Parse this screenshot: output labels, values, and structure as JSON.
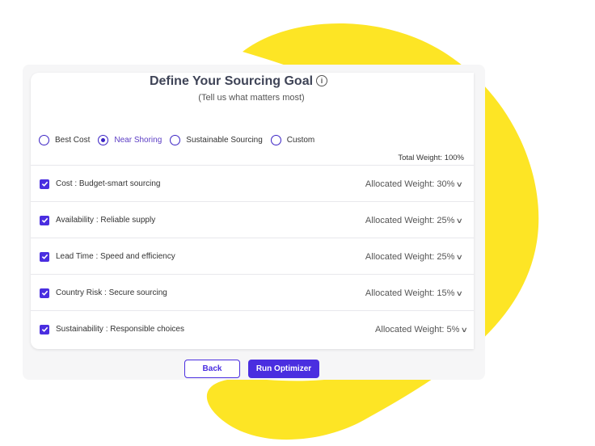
{
  "header": {
    "title": "Define Your Sourcing Goal",
    "subtitle": "(Tell us what matters most)"
  },
  "goal_options": [
    {
      "label": "Best Cost",
      "selected": false
    },
    {
      "label": "Near Shoring",
      "selected": true
    },
    {
      "label": "Sustainable Sourcing",
      "selected": false
    },
    {
      "label": "Custom",
      "selected": false
    }
  ],
  "total_weight_label": "Total Weight: 100%",
  "criteria": [
    {
      "label": "Cost : Budget-smart sourcing",
      "weight": "Allocated Weight: 30%",
      "checked": true
    },
    {
      "label": "Availability : Reliable supply",
      "weight": "Allocated Weight: 25%",
      "checked": true
    },
    {
      "label": "Lead Time : Speed and efficiency",
      "weight": "Allocated Weight: 25%",
      "checked": true
    },
    {
      "label": "Country Risk : Secure sourcing",
      "weight": "Allocated Weight: 15%",
      "checked": true
    },
    {
      "label": "Sustainability : Responsible choices",
      "weight": "Allocated Weight: 5%",
      "checked": true
    }
  ],
  "buttons": {
    "back": "Back",
    "run": "Run Optimizer"
  },
  "colors": {
    "accent": "#4a2ee0",
    "blob": "#fde525"
  },
  "icons": {
    "info": "info-circle-icon",
    "check": "checkmark-icon",
    "chevron": "chevron-down-icon"
  }
}
